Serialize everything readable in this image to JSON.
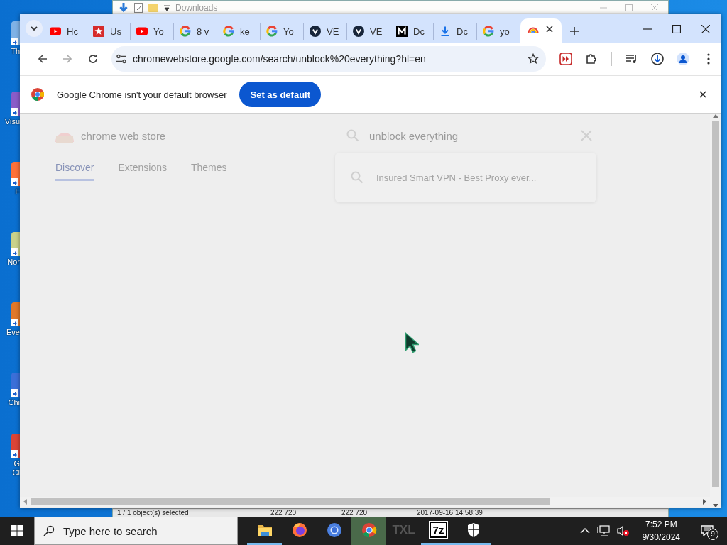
{
  "desktop_icons": [
    {
      "label": "Th",
      "color": "#7fb2e6"
    },
    {
      "label": "Visu",
      "color": "#8a5cc8"
    },
    {
      "label": "F",
      "color": "#ff7139"
    },
    {
      "label": "Nor",
      "color": "#c9d28a"
    },
    {
      "label": "Eve",
      "color": "#e0782a"
    },
    {
      "label": "Chi",
      "color": "#3b6fd8"
    },
    {
      "label": "G\nCl",
      "color": "#db4437"
    }
  ],
  "background_window": {
    "title": "Downloads",
    "status": [
      "1 / 1 object(s) selected",
      "222 720",
      "222 720",
      "2017-09-16 14:58:39"
    ]
  },
  "browser": {
    "tabs": [
      {
        "kind": "youtube",
        "label": "Hc",
        "selected": false
      },
      {
        "kind": "star",
        "label": "Us",
        "selected": false
      },
      {
        "kind": "youtube",
        "label": "Yo",
        "selected": false
      },
      {
        "kind": "google",
        "label": "8 v",
        "selected": false
      },
      {
        "kind": "google",
        "label": "ke",
        "selected": false
      },
      {
        "kind": "google",
        "label": "Yo",
        "selected": false
      },
      {
        "kind": "v",
        "label": "VE",
        "selected": false
      },
      {
        "kind": "v",
        "label": "VE",
        "selected": false
      },
      {
        "kind": "m",
        "label": "Dc",
        "selected": false
      },
      {
        "kind": "download",
        "label": "Dc",
        "selected": false
      },
      {
        "kind": "google",
        "label": "yo",
        "selected": false
      },
      {
        "kind": "rainbow",
        "selected": true
      }
    ],
    "address": "chromewebstore.google.com/search/unblock%20everything?hl=en",
    "infobar": {
      "message": "Google Chrome isn't your default browser",
      "button": "Set as default"
    },
    "page": {
      "logo_text": "chrome web store",
      "search_value": "unblock everything",
      "nav": [
        {
          "label": "Discover",
          "selected": true
        },
        {
          "label": "Extensions",
          "selected": false
        },
        {
          "label": "Themes",
          "selected": false
        }
      ],
      "suggestion": "Insured Smart VPN - Best Proxy ever..."
    }
  },
  "taskbar": {
    "search_placeholder": "Type here to search",
    "apps": [
      {
        "kind": "folder",
        "active": false,
        "running": true
      },
      {
        "kind": "firefox",
        "active": false,
        "running": false
      },
      {
        "kind": "chromium",
        "active": false,
        "running": false
      },
      {
        "kind": "chrome",
        "active": true,
        "running": false
      },
      {
        "kind": "text",
        "label": "TXL",
        "active": false,
        "running": false
      },
      {
        "kind": "box",
        "label": "7z",
        "active": false,
        "running": true
      },
      {
        "kind": "shield",
        "active": false,
        "running": true
      }
    ],
    "time": "7:52 PM",
    "date": "9/30/2024",
    "notification_count": "9"
  }
}
